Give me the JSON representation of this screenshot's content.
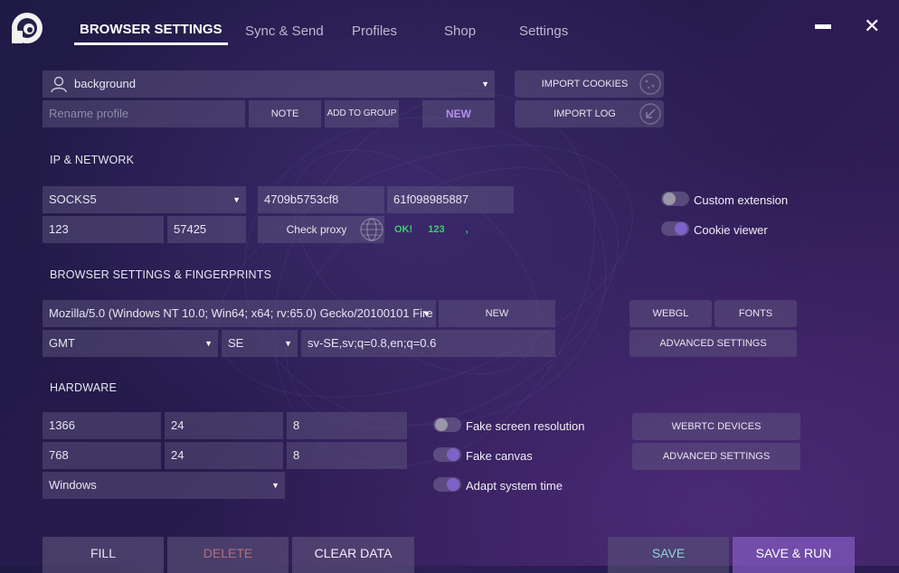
{
  "nav": {
    "tabs": [
      "BROWSER SETTINGS",
      "Sync & Send",
      "Profiles",
      "Shop",
      "Settings"
    ],
    "minimize_label": "—",
    "close_label": "✕"
  },
  "profile": {
    "selected": "background",
    "rename_placeholder": "Rename profile",
    "note_label": "NOTE",
    "add_to_group_label": "ADD TO GROUP",
    "new_label": "NEW",
    "import_cookies_label": "IMPORT COOKIES",
    "import_log_label": "IMPORT LOG"
  },
  "network": {
    "title": "IP & NETWORK",
    "proxy_type": "SOCKS5",
    "login": "4709b5753cf8",
    "password": "61f098985887",
    "host": "123",
    "port": "57425",
    "check_proxy_label": "Check proxy",
    "status_ok": "OK!",
    "status_ip": "123",
    "status_extra": ",",
    "custom_extension_label": "Custom extension",
    "cookie_viewer_label": "Cookie viewer",
    "custom_extension_on": false,
    "cookie_viewer_on": true
  },
  "fingerprints": {
    "title": "BROWSER SETTINGS & FINGERPRINTS",
    "user_agent": "Mozilla/5.0 (Windows NT 10.0; Win64; x64; rv:65.0) Gecko/20100101 Fire",
    "new_label": "NEW",
    "timezone": "GMT",
    "locale": "SE",
    "languages": "sv-SE,sv;q=0.8,en;q=0.6",
    "webgl_label": "WEBGL",
    "fonts_label": "FONTS",
    "advanced_label": "ADVANCED SETTINGS"
  },
  "hardware": {
    "title": "HARDWARE",
    "width": "1366",
    "height": "768",
    "depth1": "24",
    "depth2": "24",
    "cores1": "8",
    "cores2": "8",
    "os": "Windows",
    "fake_screen_label": "Fake screen resolution",
    "fake_canvas_label": "Fake canvas",
    "adapt_time_label": "Adapt system time",
    "fake_screen_on": false,
    "fake_canvas_on": true,
    "adapt_time_on": true,
    "webrtc_label": "WEBRTC DEVICES",
    "advanced_label": "ADVANCED SETTINGS"
  },
  "footer": {
    "fill_label": "FILL",
    "delete_label": "DELETE",
    "clear_label": "CLEAR DATA",
    "save_label": "SAVE",
    "save_run_label": "SAVE & RUN"
  },
  "colors": {
    "accent_purple": "#b48ef0",
    "status_green": "#38d26b",
    "save_teal": "#8fd6d6",
    "delete_red": "#b0707c"
  }
}
